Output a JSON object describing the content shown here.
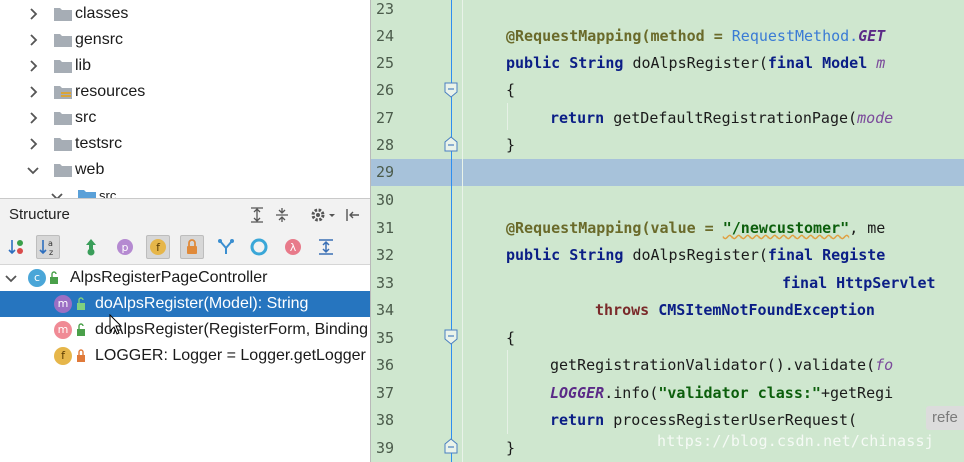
{
  "project_tree": {
    "items": [
      {
        "label": "classes",
        "expanded": false
      },
      {
        "label": "gensrc",
        "expanded": false
      },
      {
        "label": "lib",
        "expanded": false
      },
      {
        "label": "resources",
        "expanded": false
      },
      {
        "label": "src",
        "expanded": false
      },
      {
        "label": "testsrc",
        "expanded": false
      },
      {
        "label": "web",
        "expanded": true
      },
      {
        "label": "src",
        "expanded": true
      }
    ]
  },
  "structure": {
    "title": "Structure",
    "class_name": "AlpsRegisterPageController",
    "members": [
      {
        "badge": "m",
        "label": "doAlpsRegister(Model): String",
        "selected": true
      },
      {
        "badge": "m",
        "label": "doAlpsRegister(RegisterForm, Binding",
        "selected": false
      },
      {
        "badge": "f",
        "label": "LOGGER: Logger = Logger.getLogger",
        "selected": false
      }
    ],
    "toolbar_badges": {
      "p": "p",
      "f": "f",
      "lambda": "λ"
    }
  },
  "editor": {
    "line_numbers": [
      "23",
      "24",
      "25",
      "26",
      "27",
      "28",
      "29",
      "30",
      "31",
      "32",
      "33",
      "34",
      "35",
      "36",
      "37",
      "38",
      "39"
    ],
    "lines": {
      "l24_a": "@RequestMapping(method = ",
      "l24_b": "RequestMethod.",
      "l24_c": "GET",
      "l25_a": "public ",
      "l25_b": "String ",
      "l25_c": "doAlpsRegister(",
      "l25_d": "final Model ",
      "l25_e": "m",
      "l26": "{",
      "l27_a": "return ",
      "l27_b": "getDefaultRegistrationPage(",
      "l27_c": "mode",
      "l28": "}",
      "l31_a": "@RequestMapping(value = ",
      "l31_b": "\"/newcustomer\"",
      "l31_c": ", me",
      "l32_a": "public ",
      "l32_b": "String ",
      "l32_c": "doAlpsRegister(",
      "l32_d": "final Registe",
      "l33": "final HttpServlet",
      "l34_a": "throws ",
      "l34_b": "CMSItemNotFoundException",
      "l35": "{",
      "l36_a": "getRegistrationValidator().validate(",
      "l36_b": "fo",
      "l37_a": "LOGGER",
      "l37_b": ".info(",
      "l37_c": "\"validator class:\"",
      "l37_d": "+getRegi",
      "l38_a": "return ",
      "l38_b": "processRegisterUserRequest(",
      "l39": "}"
    },
    "hint": "refe",
    "watermark": "https://blog.csdn.net/chinassj"
  },
  "colors": {
    "selection": "#2675bf",
    "editor_bg": "#cfe7cf",
    "current_line": "#a7c2da",
    "keyword": "#0b1e86"
  }
}
